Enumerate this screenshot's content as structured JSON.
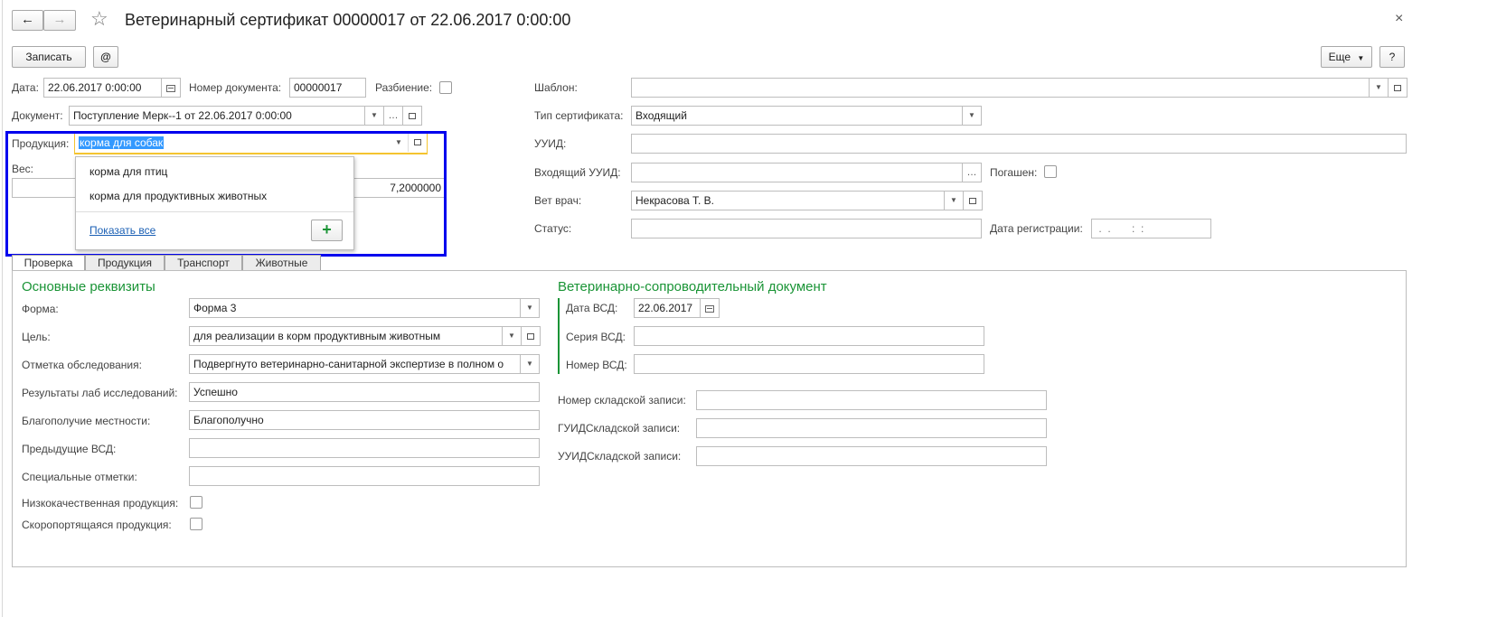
{
  "window": {
    "title": "Ветеринарный сертификат 00000017 от 22.06.2017 0:00:00",
    "close_glyph": "×",
    "back_glyph": "←",
    "forward_glyph": "→",
    "star_glyph": "☆"
  },
  "toolbar": {
    "save_label": "Записать",
    "at_label": "@",
    "more_label": "Еще",
    "help_label": "?"
  },
  "header": {
    "date_label": "Дата:",
    "date_value": "22.06.2017  0:00:00",
    "docnum_label": "Номер документа:",
    "docnum_value": "00000017",
    "split_label": "Разбиение:",
    "document_label": "Документ:",
    "document_value": "Поступление Мерк--1 от 22.06.2017 0:00:00",
    "product_label": "Продукция:",
    "product_value": "корма для собак",
    "weight_label": "Вес:",
    "weight_value": "7,2000000",
    "template_label": "Шаблон:",
    "template_value": "",
    "certtype_label": "Тип сертификата:",
    "certtype_value": "Входящий",
    "uuid_label": "УУИД:",
    "incoming_uuid_label": "Входящий УУИД:",
    "redeemed_label": "Погашен:",
    "vet_label": "Вет врач:",
    "vet_value": "Некрасова Т. В.",
    "status_label": "Статус:",
    "regdate_label": "Дата регистрации:",
    "regdate_value": " .  .       :  :"
  },
  "autocomplete": {
    "items": [
      "корма для птиц",
      "корма для продуктивных животных"
    ],
    "show_all": "Показать все",
    "add_glyph": "+"
  },
  "tabs": [
    "Проверка",
    "Продукция",
    "Транспорт",
    "Животные"
  ],
  "main": {
    "section_title": "Основные реквизиты",
    "form_label": "Форма:",
    "form_value": "Форма 3",
    "goal_label": "Цель:",
    "goal_value": "для реализации в корм продуктивным животным",
    "mark_label": "Отметка обследования:",
    "mark_value": "Подвергнуто ветеринарно-санитарной экспертизе в полном о",
    "lab_label": "Результаты лаб исследований:",
    "lab_value": "Успешно",
    "wellbeing_label": "Благополучие местности:",
    "wellbeing_value": "Благополучно",
    "prev_label": "Предыдущие ВСД:",
    "special_label": "Специальные отметки:",
    "lowq_label": "Низкокачественная продукция:",
    "perish_label": "Скоропортящаяся продукция:"
  },
  "vsd": {
    "section_title": "Ветеринарно-сопроводительный документ",
    "date_label": "Дата ВСД:",
    "date_value": "22.06.2017",
    "series_label": "Серия ВСД:",
    "number_label": "Номер ВСД:",
    "stock_num_label": "Номер складской записи:",
    "guid_label": "ГУИДСкладской записи:",
    "uuid_label": "УУИДСкладской записи:"
  },
  "colors": {
    "accent_green": "#1a9436",
    "highlight_blue": "#0000ee",
    "focus_yellow": "#f4c430",
    "selection_blue": "#3399ff",
    "link_blue": "#1a5fb4"
  }
}
